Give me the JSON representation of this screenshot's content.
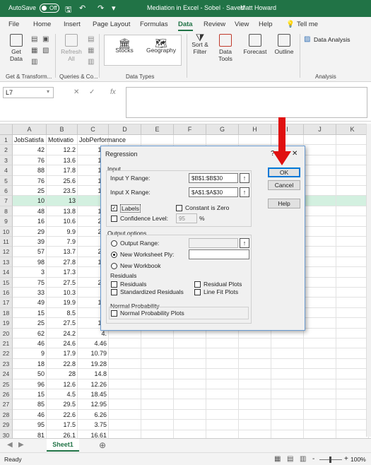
{
  "titlebar": {
    "autosave": "AutoSave",
    "toggle": "Off",
    "document": "Mediation in Excel - Sobel  ·  Saved",
    "user": "Matt Howard",
    "bg": "#217346"
  },
  "menu": {
    "items": [
      "File",
      "Home",
      "Insert",
      "Page Layout",
      "Formulas",
      "Data",
      "Review",
      "View",
      "Help"
    ],
    "active": "Data",
    "tellme": "Tell me"
  },
  "ribbon": {
    "get_data": "Get Data",
    "refresh_all": "Refresh All",
    "stocks": "Stocks",
    "geography": "Geography",
    "sort_filter": "Sort & Filter",
    "data_tools": "Data Tools",
    "forecast": "Forecast",
    "outline": "Outline",
    "data_analysis": "Data Analysis",
    "groups": [
      "Get & Transform...",
      "Queries & Co...",
      "Data Types",
      "Analysis"
    ]
  },
  "formula_bar": {
    "name_box": "L7",
    "fx": "fx"
  },
  "sheet": {
    "columns": [
      "A",
      "B",
      "C",
      "D",
      "E",
      "F",
      "G",
      "H",
      "I",
      "J",
      "K"
    ],
    "headers": [
      "JobSatisfa",
      "Motivatio",
      "JobPerformance"
    ],
    "selected_row": 7,
    "rows": [
      [
        "42",
        "12.2",
        "18."
      ],
      [
        "76",
        "13.6",
        "12."
      ],
      [
        "88",
        "17.8",
        "13."
      ],
      [
        "76",
        "25.6",
        "10."
      ],
      [
        "25",
        "23.5",
        "19."
      ],
      [
        "10",
        "13",
        "3"
      ],
      [
        "48",
        "13.8",
        "14."
      ],
      [
        "16",
        "10.6",
        "20."
      ],
      [
        "29",
        "9.9",
        "23."
      ],
      [
        "39",
        "7.9",
        "3."
      ],
      [
        "57",
        "13.7",
        "23."
      ],
      [
        "98",
        "27.8",
        "13."
      ],
      [
        "3",
        "17.3",
        "3."
      ],
      [
        "75",
        "27.5",
        "23."
      ],
      [
        "33",
        "10.3",
        "3."
      ],
      [
        "49",
        "19.9",
        "15."
      ],
      [
        "15",
        "8.5",
        "4."
      ],
      [
        "25",
        "27.5",
        "19."
      ],
      [
        "62",
        "24.2",
        "4."
      ],
      [
        "46",
        "24.6",
        "4.46"
      ],
      [
        "9",
        "17.9",
        "10.79"
      ],
      [
        "18",
        "22.8",
        "19.28"
      ],
      [
        "50",
        "28",
        "14.8"
      ],
      [
        "96",
        "12.6",
        "12.26"
      ],
      [
        "15",
        "4.5",
        "18.45"
      ],
      [
        "85",
        "29.5",
        "12.95"
      ],
      [
        "46",
        "22.6",
        "6.26"
      ],
      [
        "95",
        "17.5",
        "3.75"
      ],
      [
        "81",
        "26.1",
        "16.61"
      ]
    ]
  },
  "sheet_tab": "Sheet1",
  "status": {
    "ready": "Ready",
    "zoom": "100%",
    "minus": "-",
    "plus": "+"
  },
  "dialog": {
    "title": "Regression",
    "help_glyph": "?",
    "close_glyph": "✕",
    "input_section": "Input",
    "input_y_label": "Input Y Range:",
    "input_y_value": "$B$1:$B$30",
    "input_x_label": "Input X Range:",
    "input_x_value": "$A$1:$A$30",
    "labels": "Labels",
    "constant_zero": "Constant is Zero",
    "confidence_level": "Confidence Level:",
    "confidence_value": "95",
    "percent": "%",
    "output_section": "Output options",
    "output_range": "Output Range:",
    "new_ply": "New Worksheet Ply:",
    "new_workbook": "New Workbook",
    "residuals_section": "Residuals",
    "residuals": "Residuals",
    "std_residuals": "Standardized Residuals",
    "residual_plots": "Residual Plots",
    "line_fit_plots": "Line Fit Plots",
    "normal_section": "Normal Probability",
    "normal_plots": "Normal Probability Plots",
    "ok": "OK",
    "cancel": "Cancel",
    "help": "Help"
  },
  "accent": "#217346",
  "arrow_color": "#e01010"
}
